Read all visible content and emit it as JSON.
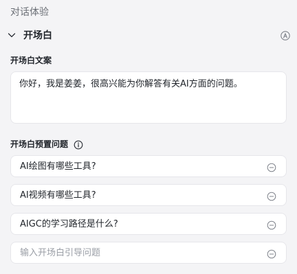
{
  "section": {
    "title": "对话体验"
  },
  "opener": {
    "title": "开场白",
    "icons": {
      "collapse": "chevron-down-icon",
      "auto": "auto-a-circle-icon"
    },
    "copy_label": "开场白文案",
    "copy_text": "你好，我是姜姜，很高兴能为你解答有关AI方面的问题。",
    "preset_label": "开场白预置问题",
    "preset_info_icon": "info-circle-icon",
    "questions": [
      {
        "text": "AI绘图有哪些工具?"
      },
      {
        "text": "AI视频有哪些工具?"
      },
      {
        "text": "AIGC的学习路径是什么?"
      }
    ],
    "new_question_placeholder": "输入开场白引导问题",
    "remove_icon": "minus-circle-icon"
  }
}
